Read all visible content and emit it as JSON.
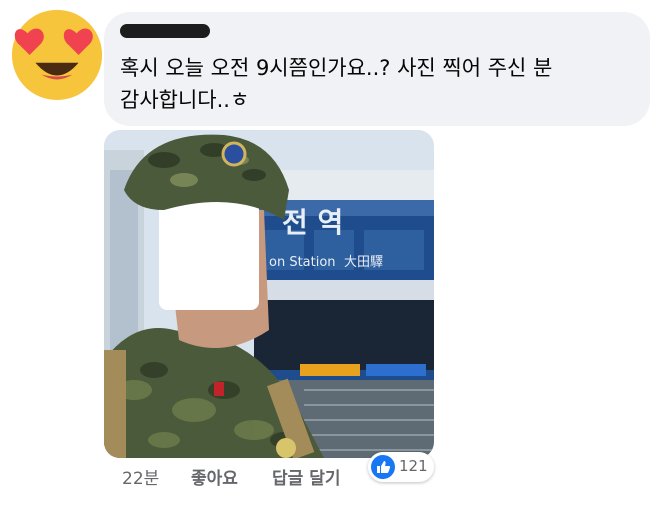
{
  "comment": {
    "text": "혹시 오늘 오전 9시쯤인가요..? 사진 찍어 주신 분\n감사합니다..ㅎ"
  },
  "photo": {
    "station_sign_korean": "전 역",
    "station_sign_english": "on Station",
    "station_sign_chinese": "大田驛",
    "colors": {
      "sky": "#d9e3ee",
      "station_glass": "#1f4c8c",
      "camo": "#4a5a3a"
    }
  },
  "actions": {
    "time": "22분",
    "like": "좋아요",
    "reply": "답글 달기"
  },
  "reactions": {
    "count": "121",
    "icon": "thumbs-up-icon",
    "color": "#1877f2"
  },
  "avatar": {
    "icon": "heart-eyes-emoji-icon"
  }
}
